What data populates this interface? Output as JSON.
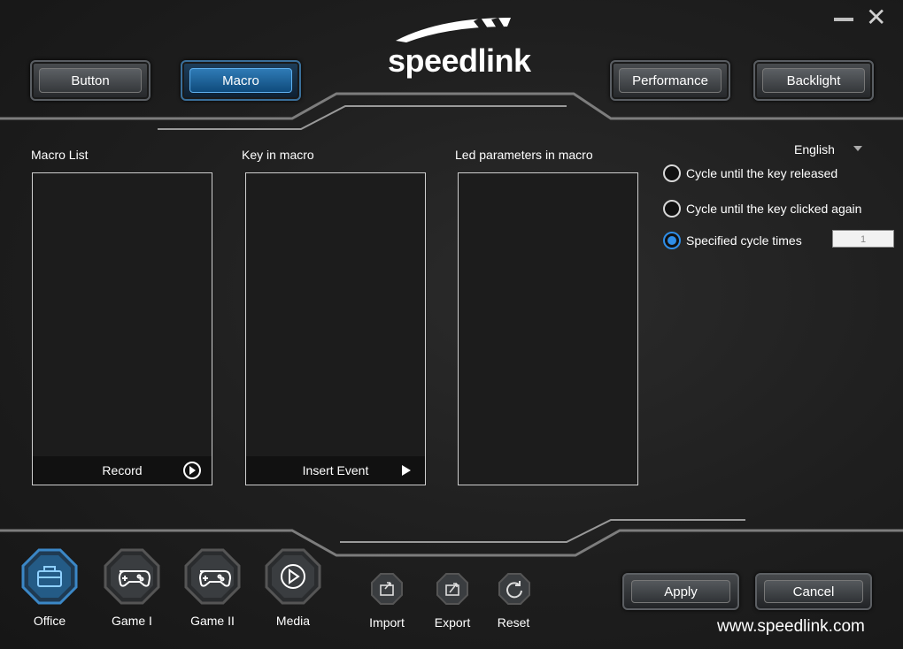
{
  "window": {
    "minimize_label": "—",
    "close_label": "✕"
  },
  "logo": {
    "text": "speedlink"
  },
  "top_tabs": [
    {
      "label": "Button",
      "active": false
    },
    {
      "label": "Macro",
      "active": true
    },
    {
      "label": "Performance",
      "active": false
    },
    {
      "label": "Backlight",
      "active": false
    }
  ],
  "panels": {
    "macro_list": {
      "label": "Macro List",
      "footer": "Record"
    },
    "key_in_macro": {
      "label": "Key in macro",
      "footer": "Insert Event"
    },
    "led_params": {
      "label": "Led parameters in macro"
    }
  },
  "language": {
    "selected": "English"
  },
  "cycle_options": [
    {
      "label": "Cycle until the key released",
      "selected": false
    },
    {
      "label": "Cycle until the key clicked again",
      "selected": false
    },
    {
      "label": "Specified cycle times",
      "selected": true
    }
  ],
  "cycle_times": {
    "value": "1"
  },
  "modes": [
    {
      "label": "Office",
      "icon": "briefcase-icon",
      "active": true
    },
    {
      "label": "Game I",
      "icon": "gamepad-icon",
      "active": false
    },
    {
      "label": "Game II",
      "icon": "gamepad-icon",
      "active": false
    },
    {
      "label": "Media",
      "icon": "play-icon",
      "active": false
    }
  ],
  "tools": [
    {
      "label": "Import",
      "icon": "import-icon"
    },
    {
      "label": "Export",
      "icon": "export-icon"
    },
    {
      "label": "Reset",
      "icon": "reset-icon"
    }
  ],
  "actions": {
    "apply_label": "Apply",
    "cancel_label": "Cancel"
  },
  "footer": {
    "url": "www.speedlink.com"
  },
  "colors": {
    "accent": "#2f8ee8",
    "active_tab": "#1f6aa6"
  }
}
